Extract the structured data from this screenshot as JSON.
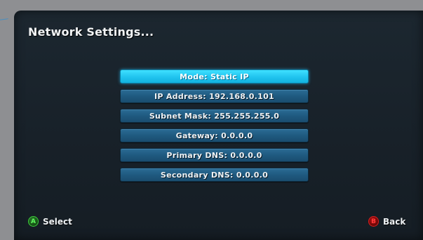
{
  "title": "Network Settings...",
  "menu": {
    "items": [
      {
        "label": "Mode: Static IP",
        "selected": true
      },
      {
        "label": "IP Address: 192.168.0.101",
        "selected": false
      },
      {
        "label": "Subnet Mask: 255.255.255.0",
        "selected": false
      },
      {
        "label": "Gateway: 0.0.0.0",
        "selected": false
      },
      {
        "label": "Primary DNS: 0.0.0.0",
        "selected": false
      },
      {
        "label": "Secondary DNS: 0.0.0.0",
        "selected": false
      }
    ]
  },
  "footer": {
    "select": {
      "button": "A",
      "label": "Select",
      "icon": "a-button-icon",
      "color": "#3dcc3d"
    },
    "back": {
      "button": "B",
      "label": "Back",
      "icon": "b-button-icon",
      "color": "#d82020"
    }
  },
  "colors": {
    "selected_item": "#23c6f0",
    "item": "#1f5a80",
    "panel": "#1c2730"
  }
}
